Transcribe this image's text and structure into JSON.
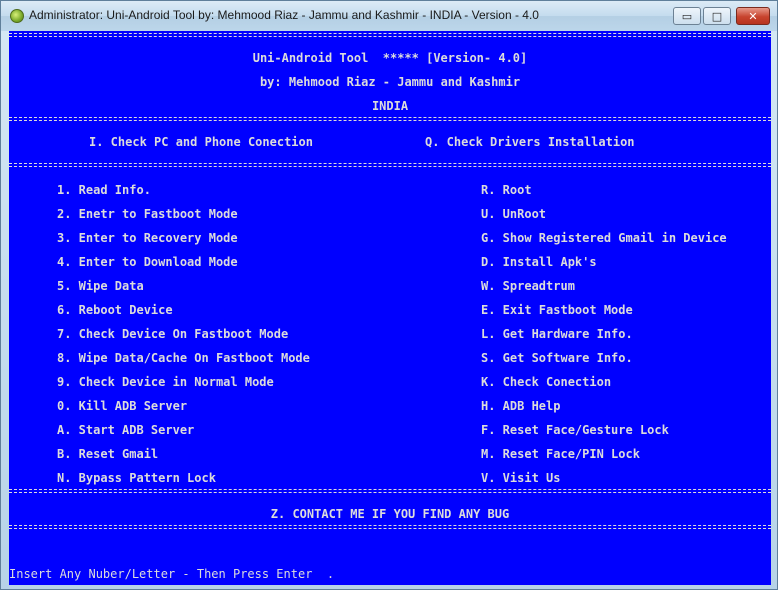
{
  "window": {
    "title": "Administrator:  Uni-Android Tool by: Mehmood Riaz - Jammu and Kashmir - INDIA - Version - 4.0",
    "minimize_glyph": "▭",
    "maximize_glyph": "□",
    "close_glyph": "✕",
    "icon": "app-icon"
  },
  "header": {
    "line1": "Uni-Android Tool  ***** [Version- 4.0]",
    "line2": "by: Mehmood Riaz - Jammu and Kashmir",
    "line3": "INDIA"
  },
  "checks": {
    "left": "I. Check PC and Phone Conection",
    "right": "Q. Check Drivers Installation"
  },
  "menu": {
    "left": [
      "1. Read Info.",
      "2. Enetr to Fastboot Mode",
      "3. Enter to Recovery Mode",
      "4. Enter to Download Mode",
      "5. Wipe Data",
      "6. Reboot Device",
      "7. Check Device On Fastboot Mode",
      "8. Wipe Data/Cache On Fastboot Mode",
      "9. Check Device in Normal Mode",
      "0. Kill ADB Server",
      "A. Start ADB Server",
      "B. Reset Gmail",
      "N. Bypass Pattern Lock"
    ],
    "right": [
      "R. Root",
      "U. UnRoot",
      "G. Show Registered Gmail in Device",
      "D. Install Apk's",
      "W. Spreadtrum",
      "E. Exit Fastboot Mode",
      "L. Get Hardware Info.",
      "S. Get Software Info.",
      "K. Check Conection",
      "H. ADB Help",
      "F. Reset Face/Gesture Lock",
      "M. Reset Face/PIN Lock",
      "V. Visit Us"
    ]
  },
  "contact": "Z. CONTACT ME IF YOU FIND ANY BUG",
  "prompt": "Insert Any Nuber/Letter - Then Press Enter  .",
  "colors": {
    "console_bg": "#0000ff",
    "console_text": "#dcdcdc",
    "close_button": "#c7432e"
  }
}
